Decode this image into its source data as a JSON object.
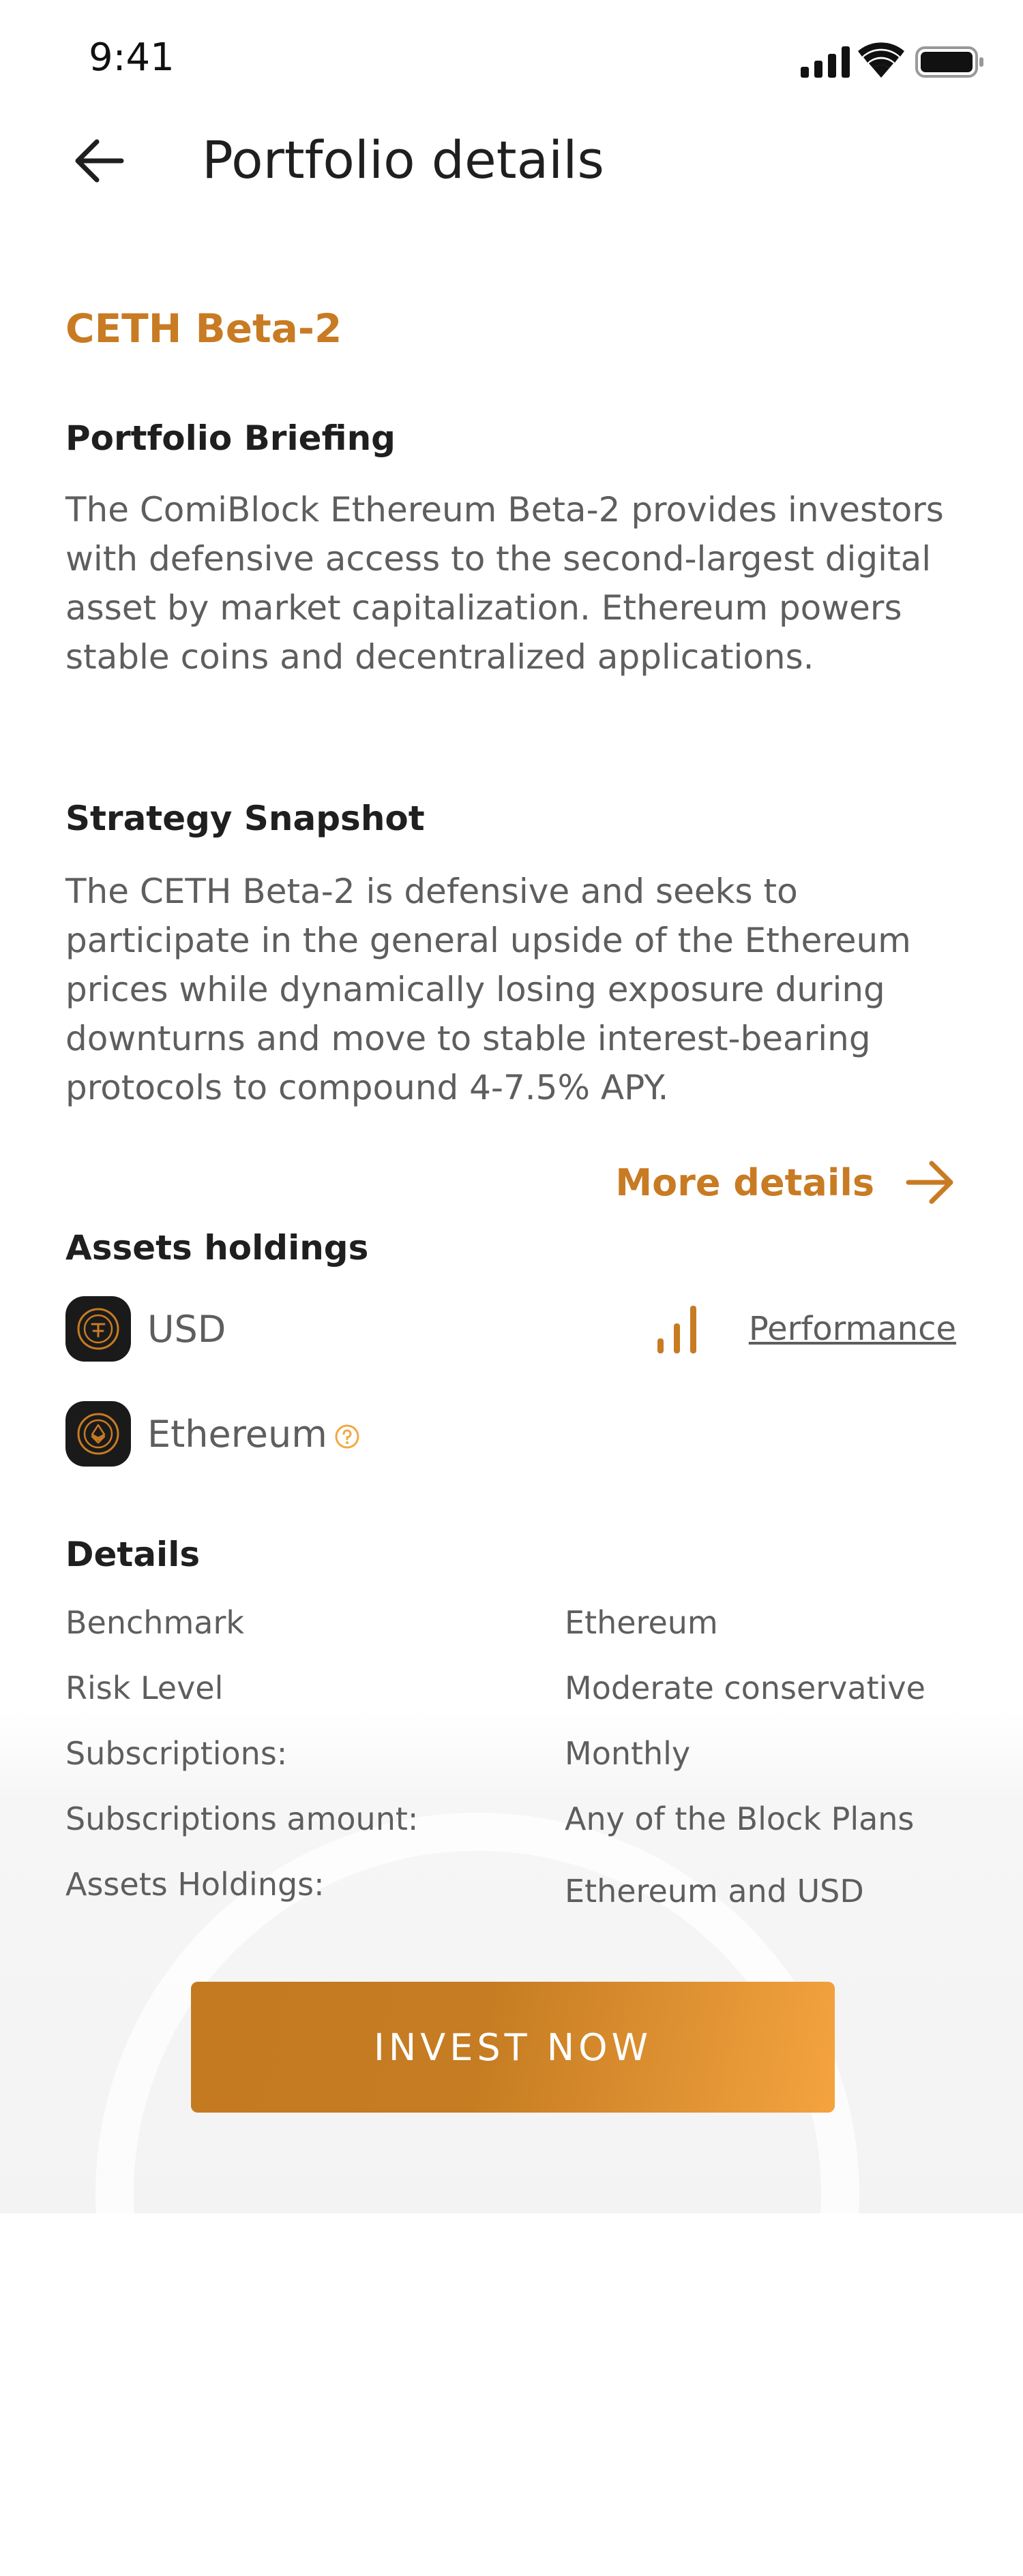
{
  "status_bar": {
    "time": "9:41"
  },
  "header": {
    "title": "Portfolio details"
  },
  "portfolio": {
    "name": "CETH Beta-2"
  },
  "briefing": {
    "title": "Portfolio  Briefing",
    "text": "The ComiBlock Ethereum Beta-2 provides investors with defensive access to the second-largest digital asset by market capitalization. Ethereum powers stable coins and decentralized applications."
  },
  "strategy": {
    "title": "Strategy Snapshot",
    "text": "The CETH Beta-2 is defensive and seeks to participate in the general upside of the Ethereum prices while dynamically losing exposure during downturns and move to stable interest-bearing protocols to compound 4-7.5% APY."
  },
  "more_details": {
    "label": "More details",
    "icon": "arrow-right-icon"
  },
  "assets": {
    "title": "Assets holdings",
    "items": [
      {
        "name": "USD",
        "icon": "usd-coin-icon"
      },
      {
        "name": "Ethereum",
        "icon": "ethereum-coin-icon"
      }
    ],
    "performance_label": "Performance"
  },
  "details": {
    "title": "Details",
    "rows": [
      {
        "label": "Benchmark",
        "value": "Ethereum"
      },
      {
        "label": "Risk Level",
        "value": "Moderate conservative"
      },
      {
        "label": "Subscriptions:",
        "value": "Monthly"
      },
      {
        "label": "Subscriptions amount:",
        "value": "Any of the Block Plans"
      },
      {
        "label": "Assets Holdings:",
        "value": "Ethereum and USD"
      }
    ]
  },
  "cta": {
    "label": "INVEST NOW"
  },
  "colors": {
    "accent": "#c87b23",
    "text": "#1f1f1f",
    "muted": "#5e5e5e",
    "cta_gradient_end": "#f4a33f"
  }
}
